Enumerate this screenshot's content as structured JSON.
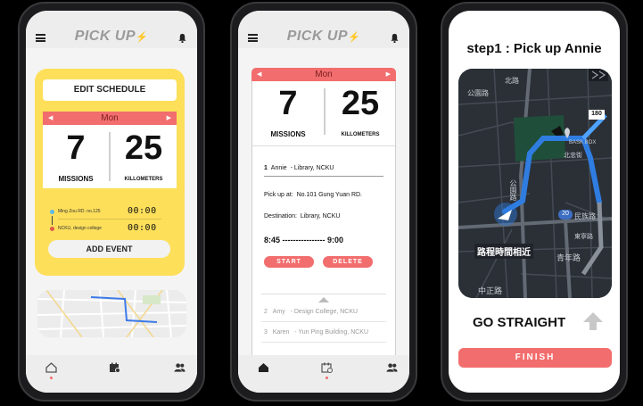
{
  "app": {
    "logo": "PICK UP"
  },
  "phone1": {
    "edit_schedule": "EDIT SCHEDULE",
    "day": "Mon",
    "missions_value": "7",
    "missions_label": "MISSIONS",
    "km_value": "25",
    "km_label": "KILLOMETERS",
    "from_address": "Ming Zou RD. no.125",
    "from_time": "00:00",
    "to_address": "NCKU, design college",
    "to_time": "00:00",
    "add_event": "ADD EVENT"
  },
  "phone2": {
    "day": "Mon",
    "missions_value": "7",
    "missions_label": "MISSIONS",
    "km_value": "25",
    "km_label": "KILLOMETERS",
    "mission_index": "1",
    "mission_name": "Annie",
    "mission_place": "- Library, NCKU",
    "pickup_label": "Pick up at:",
    "pickup_value": "No.101 Gung Yuan RD.",
    "destination_label": "Destination:",
    "destination_value": "Library, NCKU",
    "time_range": "8:45 ---------------- 9:00",
    "start_label": "START",
    "delete_label": "DELETE",
    "list": [
      {
        "index": "2",
        "name": "Amy",
        "place": "- Design College, NCKU"
      },
      {
        "index": "3",
        "name": "Karen",
        "place": "- Yun Ping Building, NCKU"
      }
    ]
  },
  "phone3": {
    "step_title": "step1 : Pick up Annie",
    "map_labels": {
      "road_top": "公園路",
      "road_north": "北路",
      "road_mid": "公園路",
      "box": "BASK BOX",
      "ne_road": "北忠街",
      "min_zu": "民族路",
      "east_road": "東寧路",
      "bottom_road": "青年路",
      "zhongshan": "中正路",
      "badge_20": "20",
      "badge_180": "180",
      "eta": "路程時間相近"
    },
    "instruction": "GO STRAIGHT",
    "finish": "FINISH"
  },
  "colors": {
    "accent": "#f26d6d",
    "card": "#fddf5a",
    "route": "#4da3ff"
  }
}
